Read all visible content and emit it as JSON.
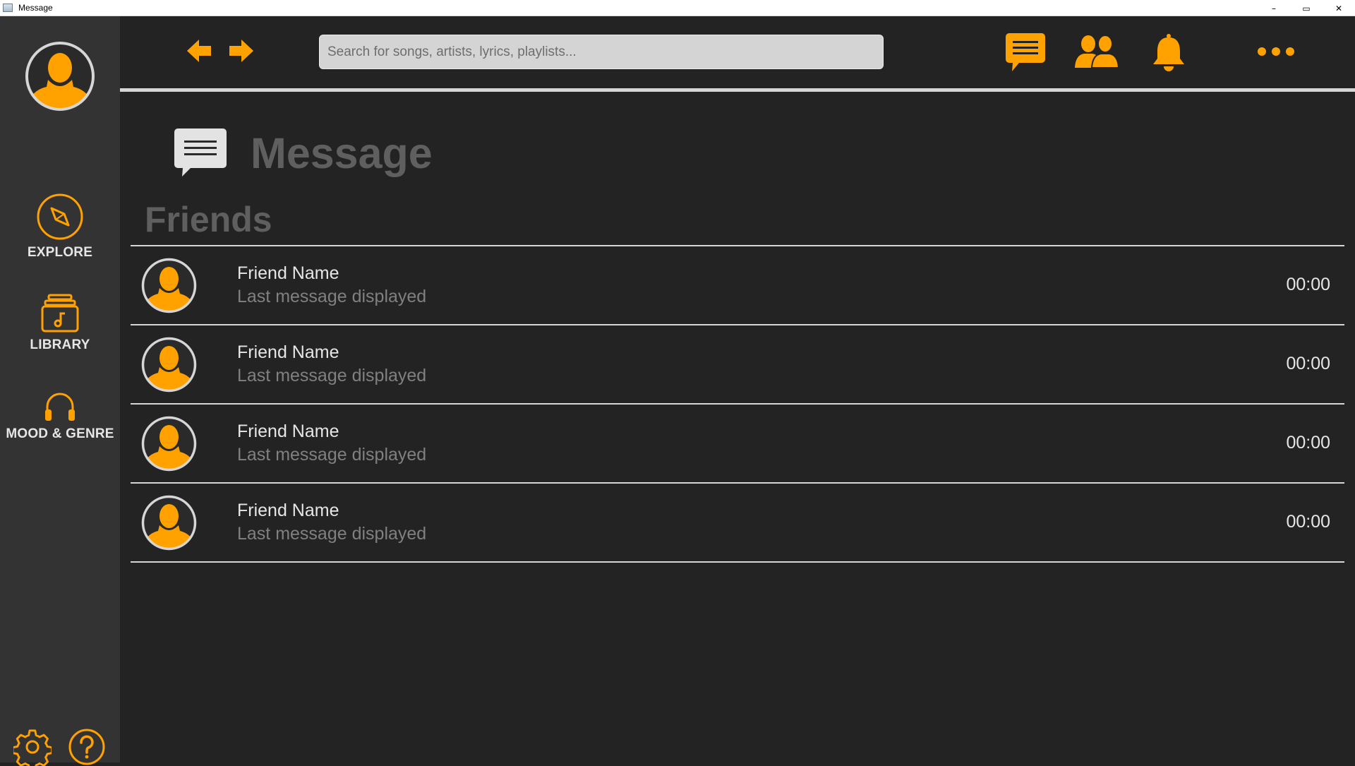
{
  "window": {
    "title": "Message",
    "controls": [
      "–",
      "▭",
      "✕"
    ]
  },
  "colors": {
    "accent": "#FFA200",
    "sidebar_bg": "#333333",
    "main_bg": "#232323",
    "title_gray": "#5F5F5F"
  },
  "sidebar": {
    "items": [
      {
        "label": "EXPLORE",
        "icon": "compass-icon"
      },
      {
        "label": "LIBRARY",
        "icon": "music-library-icon"
      },
      {
        "label": "MOOD & GENRE",
        "icon": "headphones-icon"
      }
    ],
    "bottom": [
      {
        "icon": "settings-gear-icon"
      },
      {
        "icon": "help-question-icon"
      }
    ]
  },
  "topbar": {
    "search_placeholder": "Search for songs, artists, lyrics, playlists...",
    "icons": [
      "back-arrow-icon",
      "forward-arrow-icon",
      "messages-icon",
      "friends-icon",
      "notifications-bell-icon",
      "more-options-icon"
    ]
  },
  "main": {
    "title": "Message",
    "section": "Friends",
    "conversations": [
      {
        "name": "Friend Name",
        "last_message": "Last message displayed",
        "time": "00:00"
      },
      {
        "name": "Friend Name",
        "last_message": "Last message displayed",
        "time": "00:00"
      },
      {
        "name": "Friend Name",
        "last_message": "Last message displayed",
        "time": "00:00"
      },
      {
        "name": "Friend Name",
        "last_message": "Last message displayed",
        "time": "00:00"
      }
    ]
  }
}
